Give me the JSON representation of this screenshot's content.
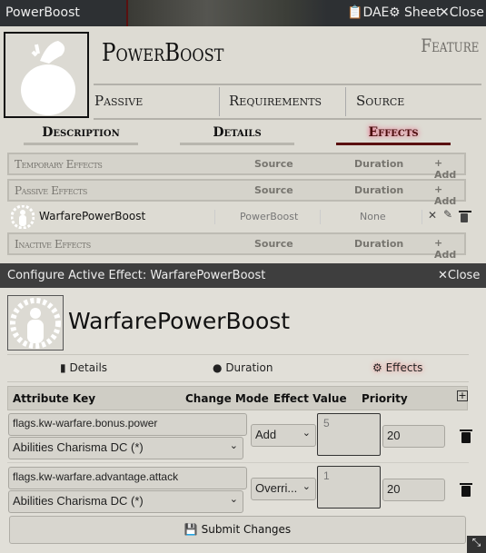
{
  "sheet": {
    "window_title": "PowerBoost",
    "header_buttons": {
      "dae": "DAE",
      "sheet": "Sheet",
      "close": "Close"
    },
    "item_name": "PowerBoost",
    "item_type": "Feature",
    "summary": [
      "Passive",
      "Requirements",
      "Source"
    ],
    "tabs": [
      "Description",
      "Details",
      "Effects"
    ],
    "active_tab": "Effects",
    "effect_sections": [
      {
        "label": "Temporary Effects",
        "source": "Source",
        "duration": "Duration",
        "add": "Add"
      },
      {
        "label": "Passive Effects",
        "source": "Source",
        "duration": "Duration",
        "add": "Add"
      },
      {
        "label": "Inactive Effects",
        "source": "Source",
        "duration": "Duration",
        "add": "Add"
      }
    ],
    "effect_item": {
      "name": "WarfarePowerBoost",
      "source": "PowerBoost",
      "duration": "None"
    }
  },
  "dialog": {
    "title": "Configure Active Effect: WarfarePowerBoost",
    "close": "Close",
    "effect_name": "WarfarePowerBoost",
    "tabs": [
      "Details",
      "Duration",
      "Effects"
    ],
    "active_tab": "Effects",
    "columns": [
      "Attribute Key",
      "Change Mode",
      "Effect Value",
      "Priority"
    ],
    "changes": [
      {
        "key": "flags.kw-warfare.bonus.power",
        "attribute_select": "Abilities Charisma DC (*)",
        "mode": "Add",
        "value": "5",
        "priority": "20"
      },
      {
        "key": "flags.kw-warfare.advantage.attack",
        "attribute_select": "Abilities Charisma DC (*)",
        "mode": "Overri...",
        "value": "1",
        "priority": "20"
      }
    ],
    "submit": "Submit Changes"
  },
  "colors": {
    "accent": "#5a1010",
    "parchment": "#dddbd3",
    "titlebar": "#3e3e3e"
  }
}
